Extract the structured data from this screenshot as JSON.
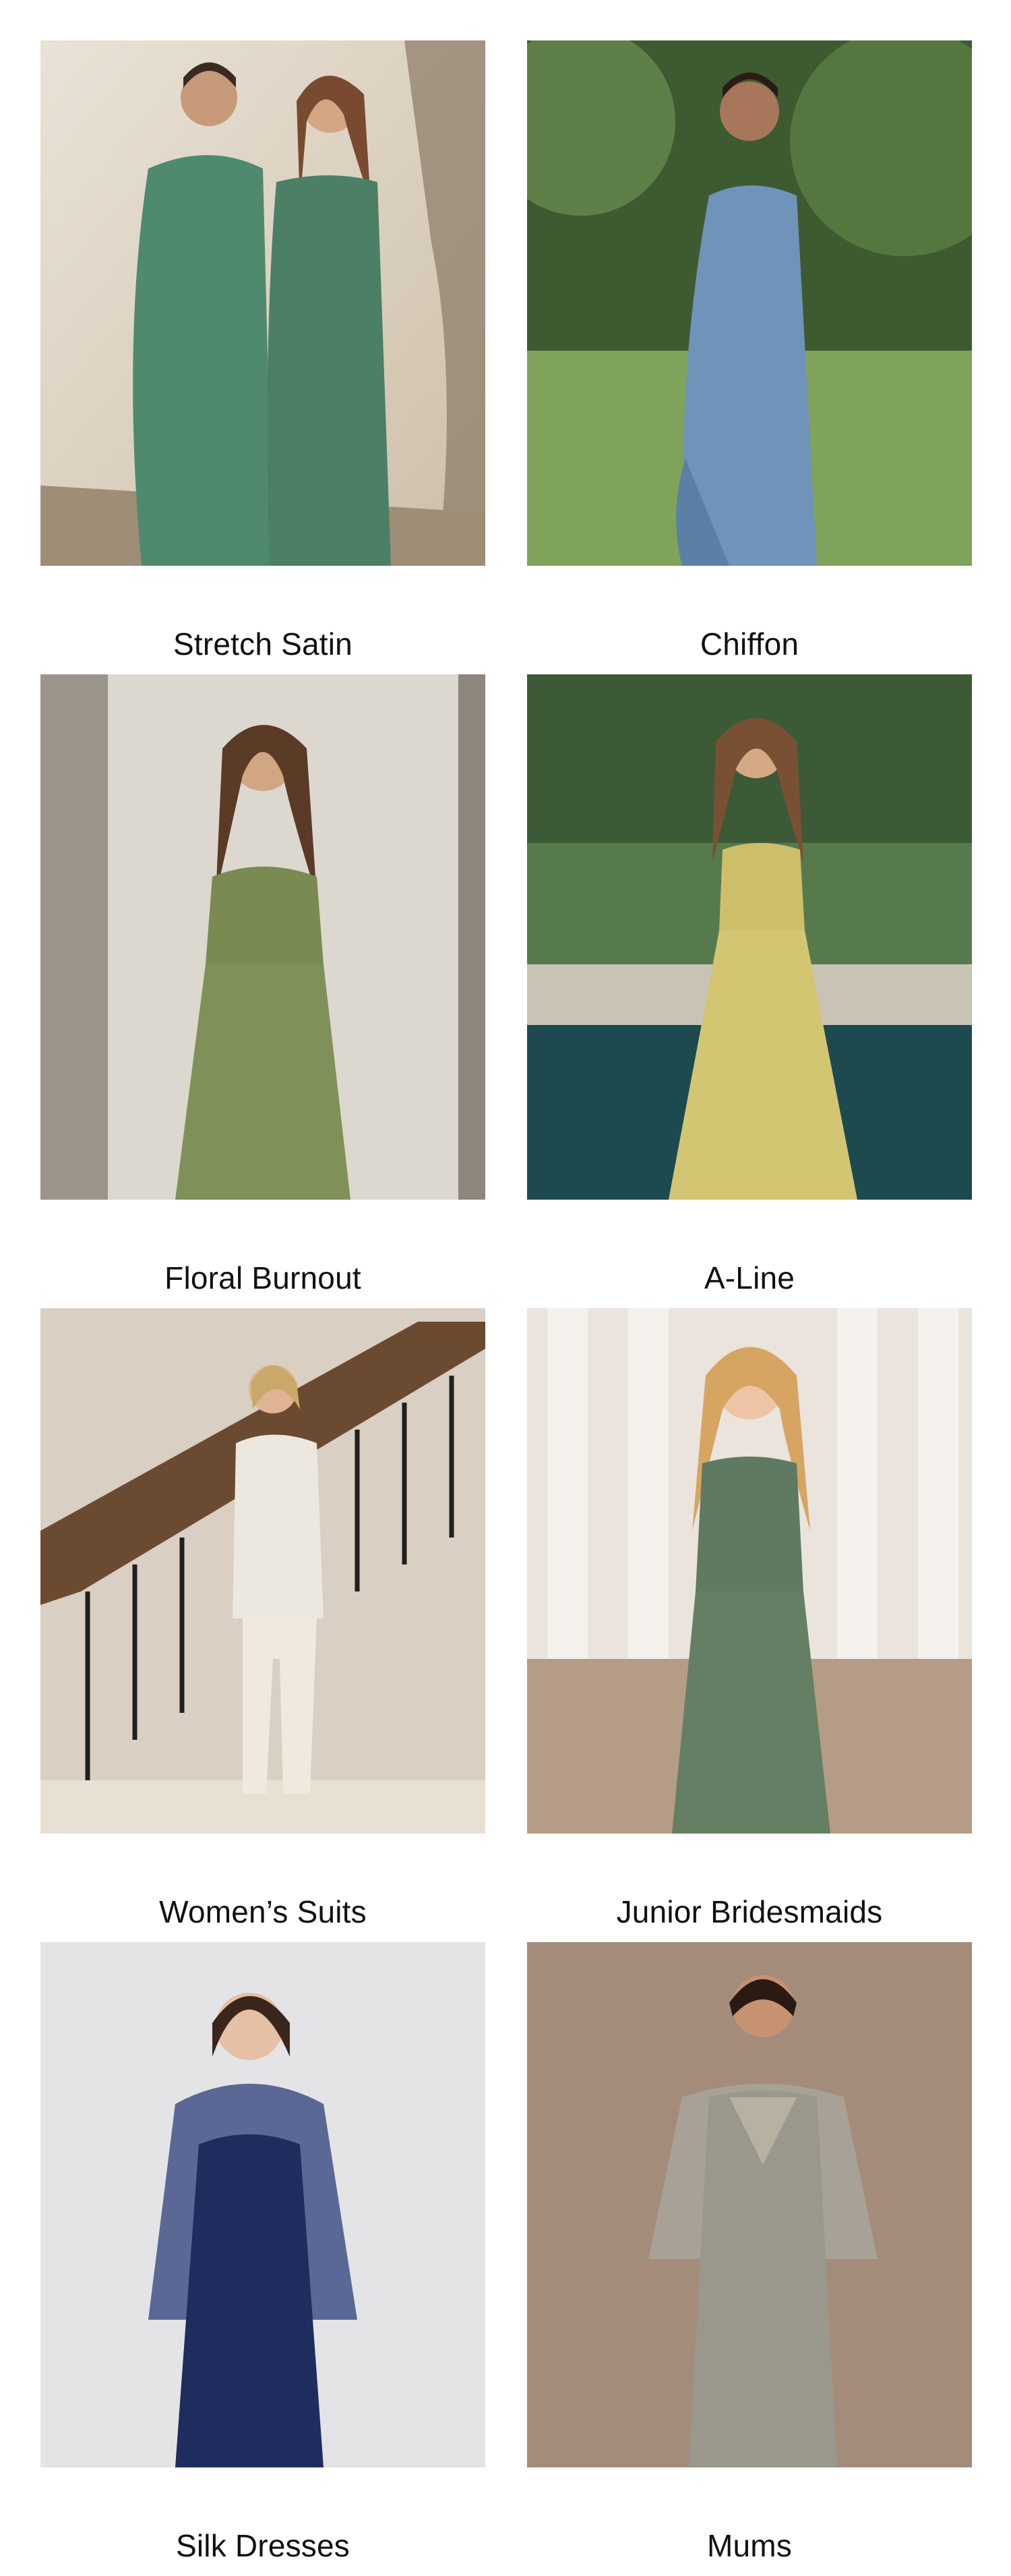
{
  "categories": [
    {
      "label": "Stretch Satin"
    },
    {
      "label": "Chiffon"
    },
    {
      "label": "Floral Burnout"
    },
    {
      "label": "A-Line"
    },
    {
      "label": "Women’s Suits"
    },
    {
      "label": "Junior Bridesmaids"
    },
    {
      "label": "Silk Dresses"
    },
    {
      "label": "Mums"
    }
  ],
  "colors": {
    "stretch_satin_dress": "#4f8a6f",
    "chiffon_dress": "#6f93b9",
    "floral_burnout_dress": "#7a8b52",
    "a_line_dress": "#cdbf6a",
    "suit": "#ece7df",
    "junior_dress": "#5f7a60",
    "silk_dress": "#1f2c5e",
    "mums_dress": "#9a978d"
  }
}
